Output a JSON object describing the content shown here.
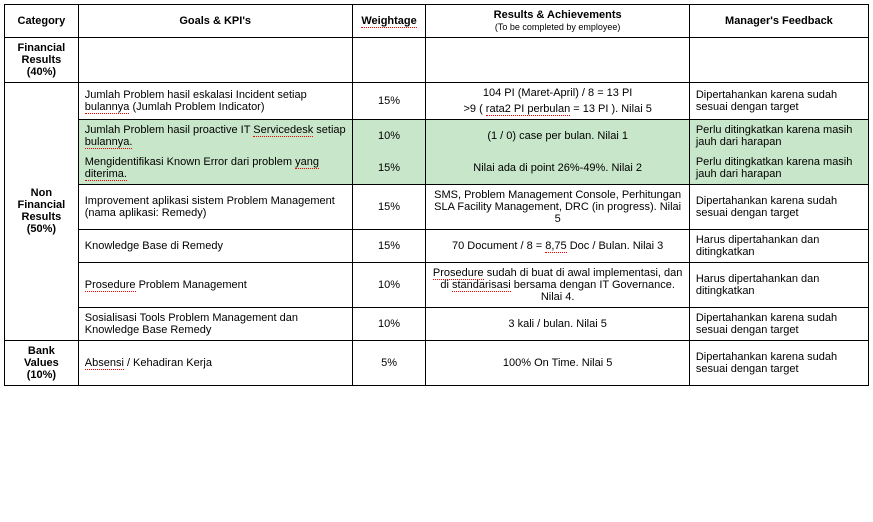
{
  "headers": {
    "category": "Category",
    "goals": "Goals & KPI's",
    "weightage": "Weightage",
    "results": "Results & Achievements",
    "results_sub": "(To be completed by employee)",
    "feedback": "Manager's Feedback"
  },
  "categories": {
    "financial": "Financial Results (40%)",
    "non_financial": "Non Financial Results (50%)",
    "bank_values": "Bank Values (10%)"
  },
  "rows": [
    {
      "goals": "Jumlah Problem hasil eskalasi Incident setiap ",
      "goals_dotted": "bulannya",
      "goals_after": " (Jumlah Problem Indicator)",
      "weight": "15%",
      "results_line1": "104 PI (Maret-April)  / 8 = 13 PI",
      "results_line2_pre": ">9 ( ",
      "results_line2_dot": "rata2 PI perbulan",
      "results_line2_post": " = 13 PI ). Nilai 5",
      "feedback": "Dipertahankan karena sudah sesuai dengan target"
    },
    {
      "goals_line1_pre": "Jumlah Problem hasil proactive IT ",
      "goals_line1_dot": "Servicedesk",
      "goals_line1_post": " setiap ",
      "goals_line1_dot2": "bulannya.",
      "weight": "10%",
      "results": "(1 / 0) case per bulan.  Nilai 1",
      "feedback": "Perlu ditingkatkan karena masih jauh dari harapan"
    },
    {
      "goals_pre": "Mengidentifikasi Known Error dari problem ",
      "goals_dot": "yang  diterima.",
      "weight": "15%",
      "results": "Nilai ada di point 26%-49%. Nilai 2",
      "feedback": "Perlu ditingkatkan karena masih jauh dari harapan"
    },
    {
      "goals": "Improvement aplikasi sistem Problem Management (nama aplikasi: Remedy)",
      "weight": "15%",
      "results": "SMS, Problem Management Console, Perhitungan SLA Facility Management, DRC (in progress). Nilai 5",
      "feedback": "Dipertahankan karena sudah sesuai dengan target"
    },
    {
      "goals": "Knowledge Base di Remedy",
      "weight": "15%",
      "results_pre": "70 Document / 8 = ",
      "results_dot": "8,75",
      "results_post": " Doc / Bulan. Nilai 3",
      "feedback": "Harus dipertahankan dan ditingkatkan"
    },
    {
      "goals_dot": "Prosedure",
      "goals_post": " Problem Management",
      "weight": "10%",
      "results_dot1": "Prosedure",
      "results_mid": " sudah di buat di awal implementasi, dan di ",
      "results_dot2": "standarisasi",
      "results_post": " bersama dengan IT Governance. Nilai 4.",
      "feedback": "Harus dipertahankan dan ditingkatkan"
    },
    {
      "goals": "Sosialisasi  Tools Problem Management dan Knowledge Base Remedy",
      "weight": "10%",
      "results": "3 kali / bulan. Nilai 5",
      "feedback": "Dipertahankan karena sudah sesuai dengan target"
    },
    {
      "goals_dot": "Absensi",
      "goals_post": "  / Kehadiran Kerja",
      "weight": "5%",
      "results": "100% On Time.  Nilai 5",
      "feedback": "Dipertahankan karena sudah sesuai dengan target"
    }
  ]
}
